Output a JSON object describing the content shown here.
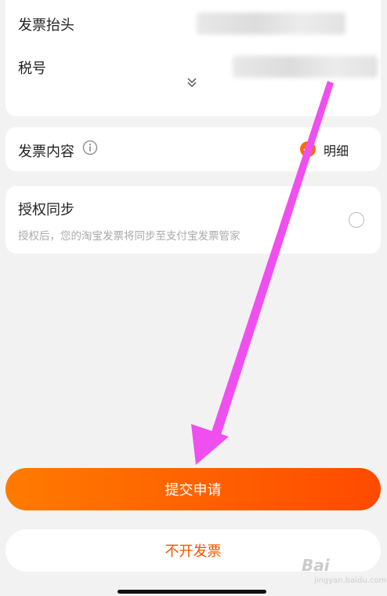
{
  "invoice_form": {
    "title_label": "发票抬头",
    "tax_id_label": "税号",
    "expand_icon": "double-chevron-down-icon"
  },
  "content_section": {
    "label": "发票内容",
    "info_icon": "info-circle-icon",
    "option": "明细"
  },
  "auth_section": {
    "title": "授权同步",
    "description": "授权后，您的淘宝发票将同步至支付宝发票管家"
  },
  "buttons": {
    "submit": "提交申请",
    "no_invoice": "不开发票"
  },
  "watermark": {
    "brand": "Bai",
    "sub": "jingyan.baidu.com"
  },
  "colors": {
    "accent": "#ff5000",
    "gradient_start": "#ff7a00",
    "gradient_end": "#ff4a00",
    "annotation_arrow": "#f04ff0"
  }
}
